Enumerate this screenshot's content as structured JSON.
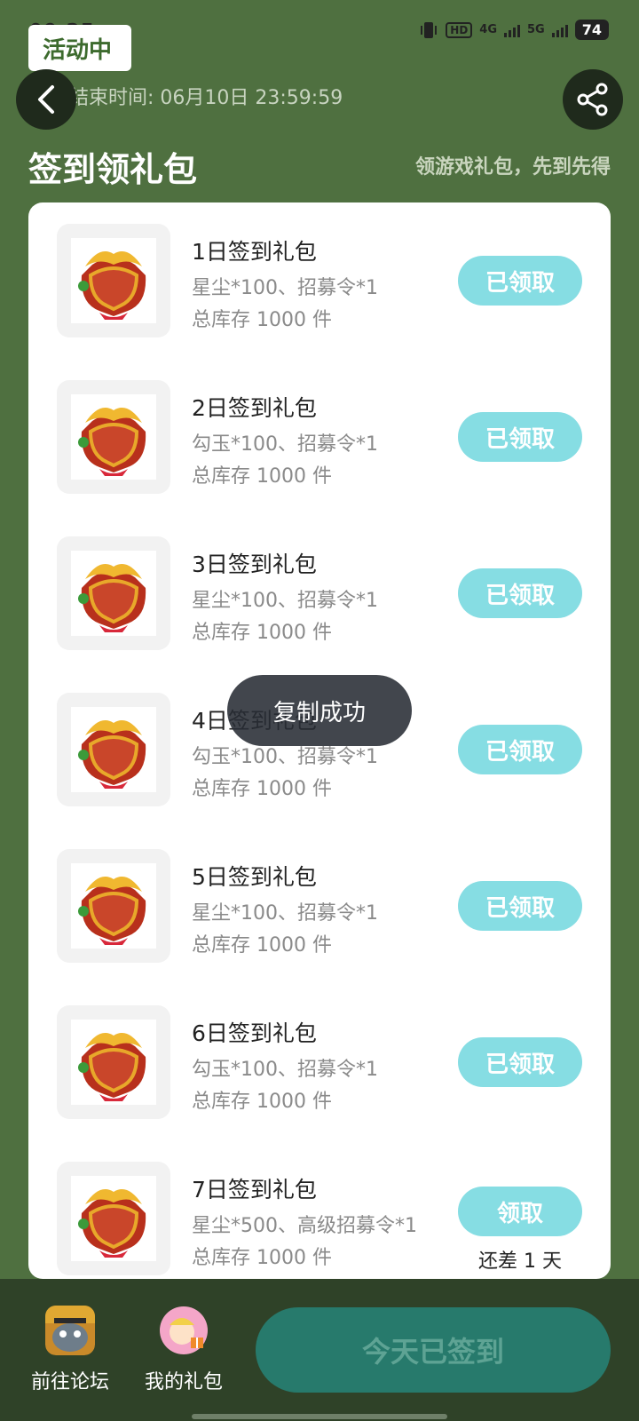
{
  "status": {
    "time": "09:35",
    "battery": "74",
    "network1": "4G",
    "network2": "5G",
    "hd": "HD"
  },
  "header": {
    "badge": "活动中",
    "end_time": "活动结束时间: 06月10日 23:59:59",
    "title": "签到领礼包",
    "subtitle": "领游戏礼包，先到先得"
  },
  "items": [
    {
      "title": "1日签到礼包",
      "desc": "星尘*100、招募令*1",
      "stock": "总库存 1000 件",
      "button": "已领取"
    },
    {
      "title": "2日签到礼包",
      "desc": "勾玉*100、招募令*1",
      "stock": "总库存 1000 件",
      "button": "已领取"
    },
    {
      "title": "3日签到礼包",
      "desc": "星尘*100、招募令*1",
      "stock": "总库存 1000 件",
      "button": "已领取"
    },
    {
      "title": "4日签到礼包",
      "desc": "勾玉*100、招募令*1",
      "stock": "总库存 1000 件",
      "button": "已领取"
    },
    {
      "title": "5日签到礼包",
      "desc": "星尘*100、招募令*1",
      "stock": "总库存 1000 件",
      "button": "已领取"
    },
    {
      "title": "6日签到礼包",
      "desc": "勾玉*100、招募令*1",
      "stock": "总库存 1000 件",
      "button": "已领取"
    },
    {
      "title": "7日签到礼包",
      "desc": "星尘*500、高级招募令*1",
      "stock": "总库存 1000 件",
      "button": "领取",
      "note": "还差 1 天"
    }
  ],
  "toast": "复制成功",
  "bottom": {
    "forum_label": "前往论坛",
    "gifts_label": "我的礼包",
    "signed_label": "今天已签到"
  },
  "colors": {
    "background": "#4f7040",
    "claim_button": "#86dde3",
    "signed_button": "#277a6c"
  }
}
